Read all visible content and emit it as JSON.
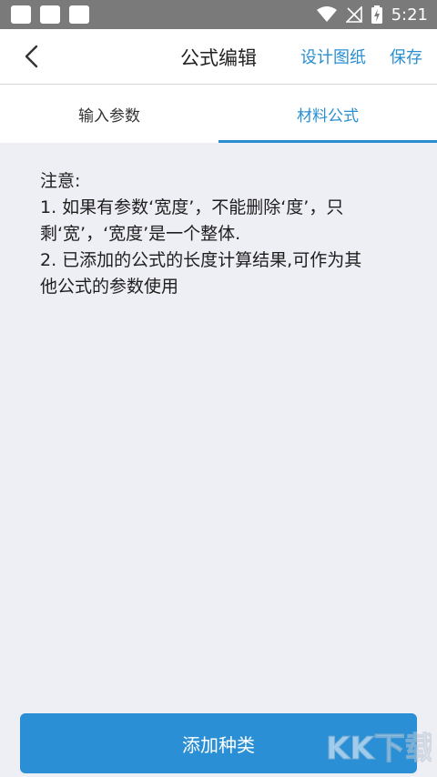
{
  "status_bar": {
    "time": "5:21"
  },
  "header": {
    "title": "公式编辑",
    "design_label": "设计图纸",
    "save_label": "保存"
  },
  "tabs": [
    {
      "label": "输入参数",
      "active": false
    },
    {
      "label": "材料公式",
      "active": true
    }
  ],
  "note": {
    "lines": [
      "注意:",
      "1. 如果有参数‘宽度’，不能删除‘度’，只",
      "剩‘宽’，‘宽度’是一个整体.",
      "2. 已添加的公式的长度计算结果,可作为其",
      "他公式的参数使用"
    ]
  },
  "bottom": {
    "add_label": "添加种类"
  },
  "watermark": {
    "text": "KK下载"
  },
  "colors": {
    "accent": "#2a8fd0",
    "background": "#eeeef5"
  }
}
